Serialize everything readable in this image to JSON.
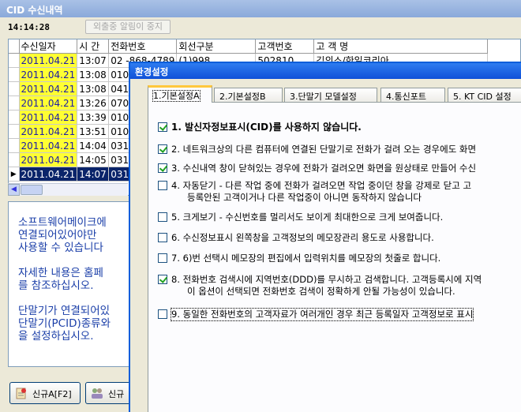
{
  "window": {
    "title": "CID 수신내역"
  },
  "toolbar": {
    "clock": "14:14:28",
    "stop_alarm_label": "외출중 알림이 중지"
  },
  "grid": {
    "columns": [
      "수신일자",
      "시 간",
      "전화번호",
      "회선구분",
      "고객번호",
      "고 객 명"
    ],
    "first_row_partial": {
      "phone": "02   -868-4789",
      "line": "(1)998",
      "custno": "502810",
      "name": "김의소/한일코리아"
    },
    "rows": [
      {
        "date": "2011.04.21",
        "time": "13:07",
        "phone": "02"
      },
      {
        "date": "2011.04.21",
        "time": "13:08",
        "phone": "010"
      },
      {
        "date": "2011.04.21",
        "time": "13:08",
        "phone": "041"
      },
      {
        "date": "2011.04.21",
        "time": "13:26",
        "phone": "070"
      },
      {
        "date": "2011.04.21",
        "time": "13:39",
        "phone": "010"
      },
      {
        "date": "2011.04.21",
        "time": "13:51",
        "phone": "010"
      },
      {
        "date": "2011.04.21",
        "time": "14:04",
        "phone": "031"
      },
      {
        "date": "2011.04.21",
        "time": "14:05",
        "phone": "031"
      },
      {
        "date": "2011.04.21",
        "time": "14:07",
        "phone": "031"
      }
    ]
  },
  "info": {
    "para1": [
      "소프트웨어메이크에",
      "연결되어있어야만 ",
      "사용할 수 있습니다"
    ],
    "para2": [
      "자세한 내용은 홈페",
      "를 참조하십시오."
    ],
    "para3": [
      "단말기가 연결되어있",
      "단말기(PCID)종류와",
      "을 설정하십시오."
    ]
  },
  "buttons": {
    "new_a": "신규A[F2]",
    "new_b": "신규"
  },
  "dialog": {
    "title": "환경설정",
    "tabs": [
      "1.기본설정A",
      "2.기본설정B",
      "3.단말기 모델설정",
      "4.통신포트",
      "5. KT CID 설정"
    ],
    "options": [
      {
        "label": "1. 발신자정보표시(CID)를 사용하지 않습니다.",
        "checked": true
      },
      {
        "label": "2. 네트워크상의 다른 컴퓨터에 연결된 단말기로 전화가 걸려 오는 경우에도 화면",
        "checked": true
      },
      {
        "label": "3. 수신내역 창이 닫혀있는 경우에 전화가 걸려오면 화면을 원상태로 만들어 수신",
        "checked": true
      },
      {
        "label": "4. 자동닫기 - 다른 작업 중에 전화가 걸려오면 작업 중이던 창을 강제로 닫고 고",
        "label2": "등록안된 고객이거나 다른 작업중이 아니면 동작하지 않습니다",
        "checked": false
      },
      {
        "label": "5. 크게보기 - 수신번호를 멀리서도 보이게 최대한으로 크게 보여줍니다.",
        "checked": false
      },
      {
        "label": "6. 수신정보표시 왼쪽창을 고객정보의 메모장관리 용도로 사용합니다.",
        "checked": false
      },
      {
        "label": "7. 6)번 선택시 메모장의 편집에서 입력위치를 메모장의 첫줄로 합니다.",
        "checked": false
      },
      {
        "label": "8. 전화번호 검색시에 지역번호(DDD)를 무시하고 검색합니다. 고객등록시에 지역",
        "label2": "이 옵션이 선택되면 전화번호 검색이 정확하게 안될 가능성이 있습니다.",
        "checked": true
      },
      {
        "label": "9. 동일한 전화번호의 고객자료가 여러개인 경우 최근 등록일자 고객정보로 표시",
        "checked": false
      }
    ]
  }
}
